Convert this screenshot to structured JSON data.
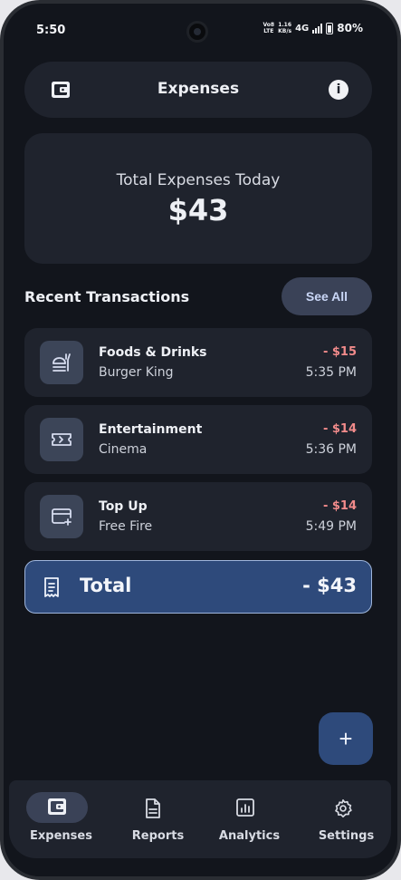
{
  "status": {
    "time": "5:50",
    "volte_top": "Vo8",
    "volte_bottom": "LTE",
    "speed_top": "1.16",
    "speed_bottom": "KB/s",
    "network": "4G",
    "battery": "80%"
  },
  "header": {
    "title": "Expenses",
    "left_icon": "wallet-icon",
    "right_icon": "info-icon"
  },
  "summary": {
    "label": "Total Expenses Today",
    "value": "$43"
  },
  "recent": {
    "title": "Recent Transactions",
    "see_all_label": "See All"
  },
  "transactions": [
    {
      "category": "Foods & Drinks",
      "merchant": "Burger King",
      "amount": "- $15",
      "time": "5:35 PM",
      "icon": "food-icon"
    },
    {
      "category": "Entertainment",
      "merchant": "Cinema",
      "amount": "- $14",
      "time": "5:36 PM",
      "icon": "ticket-icon"
    },
    {
      "category": "Top Up",
      "merchant": "Free Fire",
      "amount": "- $14",
      "time": "5:49 PM",
      "icon": "card-add-icon"
    }
  ],
  "total": {
    "label": "Total",
    "value": "- $43",
    "icon": "receipt-icon"
  },
  "fab": {
    "label": "+",
    "icon": "plus-icon"
  },
  "nav": [
    {
      "label": "Expenses",
      "icon": "wallet-icon",
      "active": true
    },
    {
      "label": "Reports",
      "icon": "document-icon",
      "active": false
    },
    {
      "label": "Analytics",
      "icon": "chart-icon",
      "active": false
    },
    {
      "label": "Settings",
      "icon": "gear-icon",
      "active": false
    }
  ],
  "colors": {
    "background": "#12151c",
    "card": "#1f232d",
    "accent": "#2e4a7b",
    "negative_amount": "#f28b8b",
    "chip": "#3a4257"
  }
}
